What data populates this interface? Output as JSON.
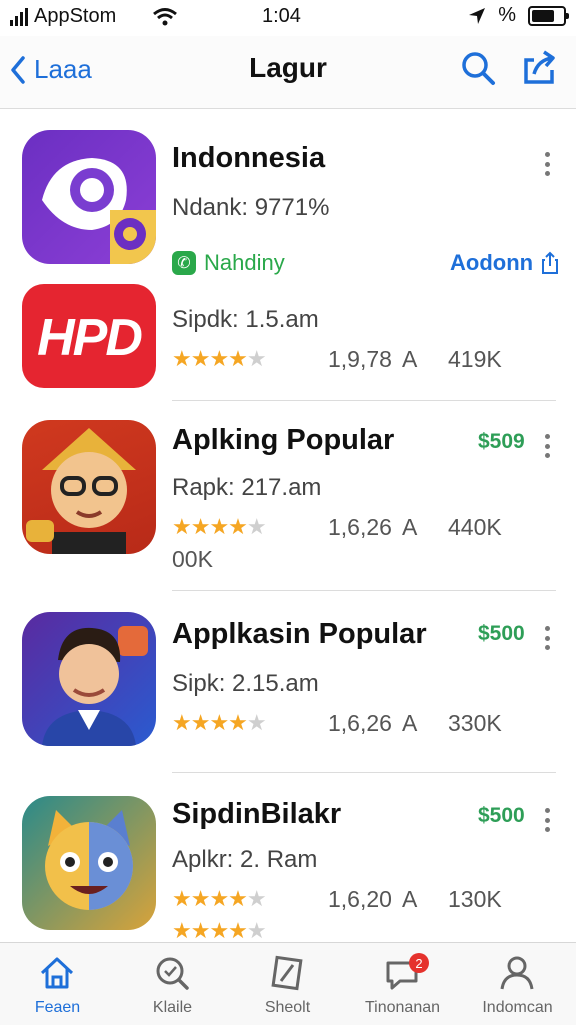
{
  "status": {
    "carrier": "AppStom",
    "time": "1:04",
    "battery_text": "%"
  },
  "nav": {
    "back_label": "Laaa",
    "title": "Lagur"
  },
  "apps": [
    {
      "name": "Indonnesia",
      "sub": "Ndank: 9771%",
      "badge_label": "Nahdiny",
      "open_label": "Aodonn"
    },
    {
      "name": "",
      "sub": "Sipdk: 1.5.am",
      "rating": "1,9,78",
      "rating_suffix": "A",
      "downloads": "419K",
      "icon_text": "HPD"
    },
    {
      "name": "Aplking Popular",
      "price": "$509",
      "sub": "Rapk: 217.am",
      "rating": "1,6,26",
      "rating_suffix": "A",
      "downloads": "440K",
      "extra": "00K"
    },
    {
      "name": "Applkasin Popular",
      "price": "$500",
      "sub": "Sipk: 2.15.am",
      "rating": "1,6,26",
      "rating_suffix": "A",
      "downloads": "330K"
    },
    {
      "name": "SipdinBilakr",
      "price": "$500",
      "sub": "Aplkr: 2. Ram",
      "rating": "1,6,20",
      "rating_suffix": "A",
      "downloads": "130K"
    }
  ],
  "tabs": [
    {
      "label": "Feaen",
      "icon": "home-icon"
    },
    {
      "label": "Klaile",
      "icon": "search-icon"
    },
    {
      "label": "Sheolt",
      "icon": "compass-icon"
    },
    {
      "label": "Tinonanan",
      "icon": "chat-icon",
      "badge": "2"
    },
    {
      "label": "Indomcan",
      "icon": "profile-icon"
    }
  ],
  "colors": {
    "accent": "#1e6fd9",
    "price": "#2e9e57",
    "star": "#f5a623",
    "badge": "#e5322d"
  }
}
